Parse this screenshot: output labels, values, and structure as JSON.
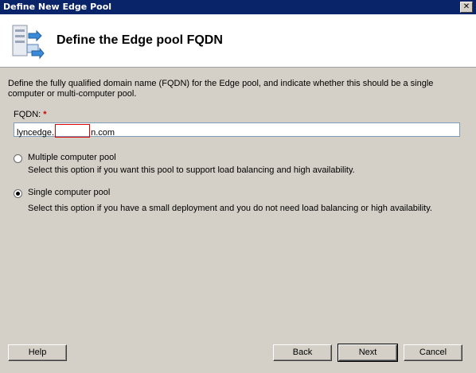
{
  "window": {
    "title": "Define New Edge Pool",
    "close_glyph": "✕"
  },
  "header": {
    "title": "Define the Edge pool FQDN",
    "icon": "server-pool-icon"
  },
  "description": "Define the fully qualified domain name (FQDN) for the Edge pool, and indicate whether this should be a single computer or multi-computer pool.",
  "fqdn": {
    "label": "FQDN:",
    "required_mark": "*",
    "value_prefix": "lyncedge.",
    "value_suffix": "n.com"
  },
  "options": [
    {
      "label": "Multiple computer pool",
      "description": "Select this option if you want this pool to support load balancing and high availability.",
      "selected": false
    },
    {
      "label": "Single computer pool",
      "description": "Select this option if you have a small deployment and you do not need load balancing or high availability.",
      "selected": true
    }
  ],
  "buttons": {
    "help": "Help",
    "back": "Back",
    "next": "Next",
    "cancel": "Cancel"
  }
}
